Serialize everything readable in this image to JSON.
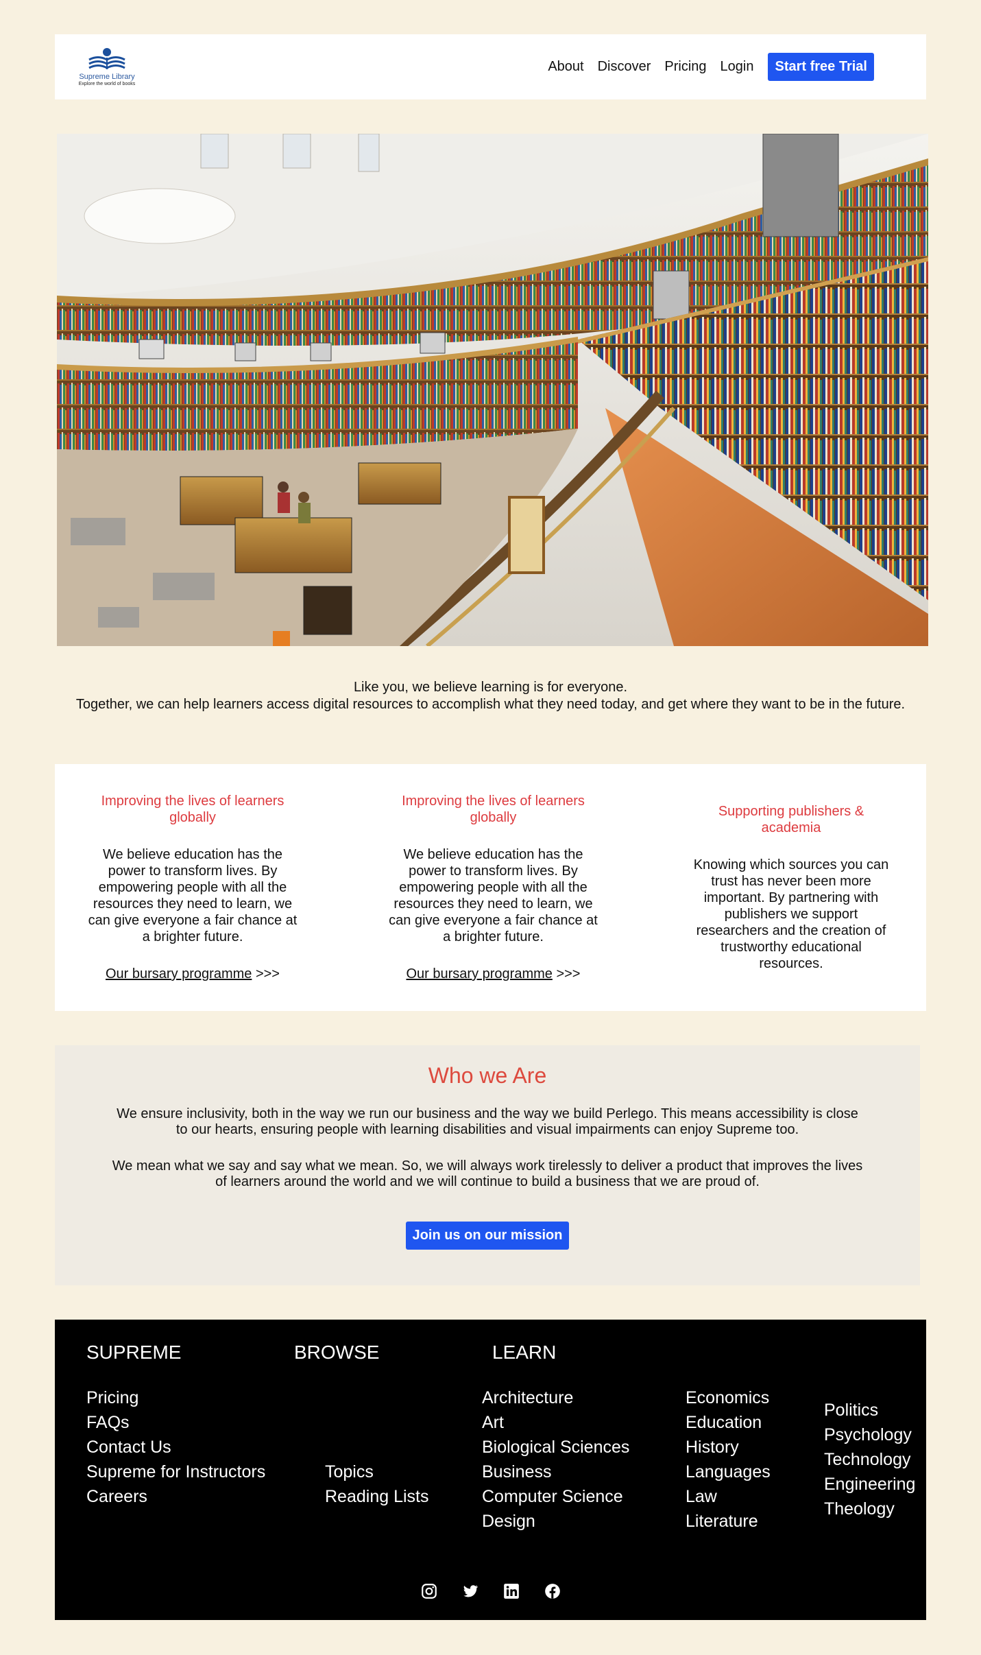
{
  "header": {
    "logo": {
      "name": "Supreme Library",
      "tagline": "Explore the world of books"
    },
    "nav": [
      "About",
      "Discover",
      "Pricing",
      "Login"
    ],
    "cta": "Start free Trial"
  },
  "intro": {
    "line1": "Like you, we believe learning is for everyone.",
    "line2": "Together, we can help learners access digital resources to accomplish what they need today, and get where they want to be in the future."
  },
  "cards": [
    {
      "title": "Improving the lives of learners globally",
      "body": "We believe education has the power to transform lives. By empowering people with all the resources they need to learn, we can give everyone a fair chance at a brighter future.",
      "link": "Our bursary programme",
      "arrows": " >>>"
    },
    {
      "title": "Improving the lives of learners globally",
      "body": "We believe education has the power to transform lives. By empowering people with all the resources they need to learn, we can give everyone a fair chance at a brighter future.",
      "link": "Our bursary programme",
      "arrows": " >>>"
    },
    {
      "title": "Supporting publishers & academia",
      "body": "Knowing which sources you can trust has never been more important. By partnering with publishers we support researchers and the creation of trustworthy educational resources."
    }
  ],
  "who": {
    "title": "Who we Are",
    "p1": "We ensure inclusivity, both in the way we run our business and the way we build Perlego. This means accessibility is close to our hearts, ensuring people with learning disabilities and visual impairments can enjoy Supreme too.",
    "p2": "We mean what we say and say what we mean. So, we will always work tirelessly to deliver a product that improves the lives of learners around the world and we will continue to build a business that we are proud of.",
    "button": "Join us on our mission"
  },
  "footer": {
    "headings": [
      "SUPREME",
      "BROWSE",
      "LEARN"
    ],
    "supreme": [
      "Pricing",
      "FAQs",
      "Contact Us",
      "Supreme for Instructors",
      "Careers"
    ],
    "browse": [
      "Topics",
      "Reading Lists"
    ],
    "learn1": [
      "Architecture",
      "Art",
      "Biological Sciences",
      "Business",
      "Computer Science",
      "Design"
    ],
    "learn2": [
      "Economics",
      "Education",
      "History",
      "Languages",
      "Law",
      "Literature"
    ],
    "learn3": [
      "Politics",
      "Psychology",
      "Technology",
      "Engineering",
      "Theology"
    ],
    "social": [
      "instagram-icon",
      "twitter-icon",
      "linkedin-icon",
      "facebook-icon"
    ]
  },
  "colors": {
    "background": "#f8f1e0",
    "accent_blue": "#1f56f0",
    "heading_red": "#dd3b3f",
    "footer_bg": "#000000"
  }
}
